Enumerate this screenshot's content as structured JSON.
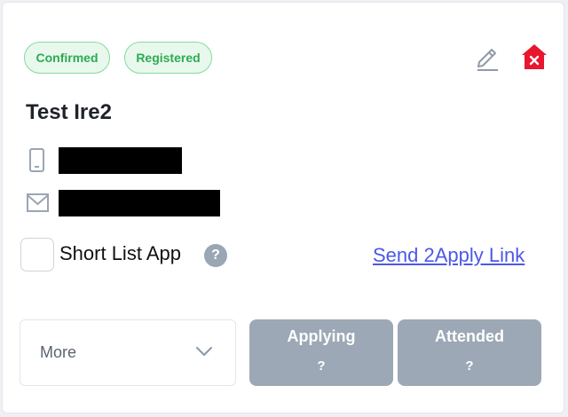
{
  "badges": {
    "confirmed": "Confirmed",
    "registered": "Registered"
  },
  "colors": {
    "badge_green": "#2eaa53",
    "remove_red": "#e8162e",
    "link_blue": "#4c58e6",
    "status_gray": "#9ca8b5"
  },
  "icons": {
    "edit": "pencil-icon",
    "remove": "house-remove-icon",
    "phone": "phone-icon",
    "mail": "mail-icon",
    "help": "help-icon",
    "chevron": "chevron-down-icon"
  },
  "candidate": {
    "name": "Test Ire2"
  },
  "shortlist": {
    "label": "Short List App",
    "help": "?",
    "checked": false
  },
  "send_link": "Send 2Apply Link",
  "more_select": {
    "label": "More"
  },
  "status": {
    "applying": {
      "label": "Applying",
      "count": "?"
    },
    "attended": {
      "label": "Attended",
      "count": "?"
    }
  }
}
